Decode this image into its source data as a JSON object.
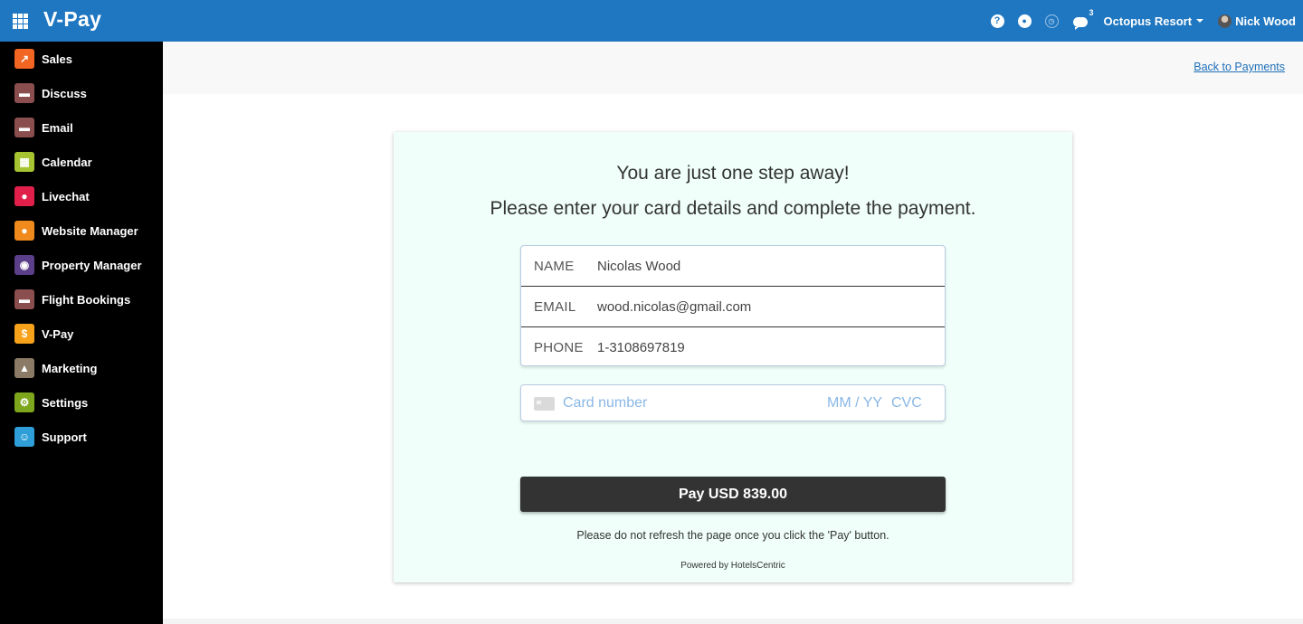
{
  "app": {
    "title": "V-Pay"
  },
  "topbar": {
    "chat_count": "3",
    "company": "Octopus Resort",
    "user": "Nick Wood",
    "icons": [
      "help-icon",
      "globe-icon",
      "clock-icon",
      "chat-icon"
    ]
  },
  "sidebar": {
    "items": [
      {
        "label": "Sales",
        "icon": "chart-icon",
        "color": "#f26522",
        "glyph": "↗"
      },
      {
        "label": "Discuss",
        "icon": "chat-icon",
        "color": "#8b4e4e",
        "glyph": "▬"
      },
      {
        "label": "Email",
        "icon": "chat-icon",
        "color": "#8b4e4e",
        "glyph": "▬"
      },
      {
        "label": "Calendar",
        "icon": "calendar-icon",
        "color": "#a6c432",
        "glyph": "▦"
      },
      {
        "label": "Livechat",
        "icon": "livechat-icon",
        "color": "#e0204a",
        "glyph": "●"
      },
      {
        "label": "Website Manager",
        "icon": "globe-icon",
        "color": "#f08a1c",
        "glyph": "●"
      },
      {
        "label": "Property Manager",
        "icon": "handshake-icon",
        "color": "#5b3f8a",
        "glyph": "◉"
      },
      {
        "label": "Flight Bookings",
        "icon": "chat-icon",
        "color": "#8b4e4e",
        "glyph": "▬"
      },
      {
        "label": "V-Pay",
        "icon": "dollar-icon",
        "color": "#f7a21b",
        "glyph": "$"
      },
      {
        "label": "Marketing",
        "icon": "paper-plane-icon",
        "color": "#8a7a66",
        "glyph": "▲"
      },
      {
        "label": "Settings",
        "icon": "gear-icon",
        "color": "#7da61d",
        "glyph": "⚙"
      },
      {
        "label": "Support",
        "icon": "support-icon",
        "color": "#2e9fd8",
        "glyph": "☺"
      }
    ]
  },
  "subheader": {
    "back_link": "Back to Payments"
  },
  "payment": {
    "headline1": "You are just one step away!",
    "headline2": "Please enter your card details and complete the payment.",
    "fields": [
      {
        "label": "NAME",
        "value": "Nicolas  Wood"
      },
      {
        "label": "EMAIL",
        "value": "wood.nicolas@gmail.com"
      },
      {
        "label": "PHONE",
        "value": " 1-3108697819"
      }
    ],
    "card_placeholder": "Card number",
    "expiry_placeholder": "MM / YY",
    "cvc_placeholder": "CVC",
    "pay_button": "Pay USD 839.00",
    "note": "Please do not refresh the page once you click the 'Pay' button.",
    "powered_by": "Powered by HotelsCentric"
  },
  "colors": {
    "topbar": "#1f77c1",
    "card_bg": "#f0fff9",
    "pay_button": "#333333",
    "placeholder": "#8ab8e6"
  }
}
